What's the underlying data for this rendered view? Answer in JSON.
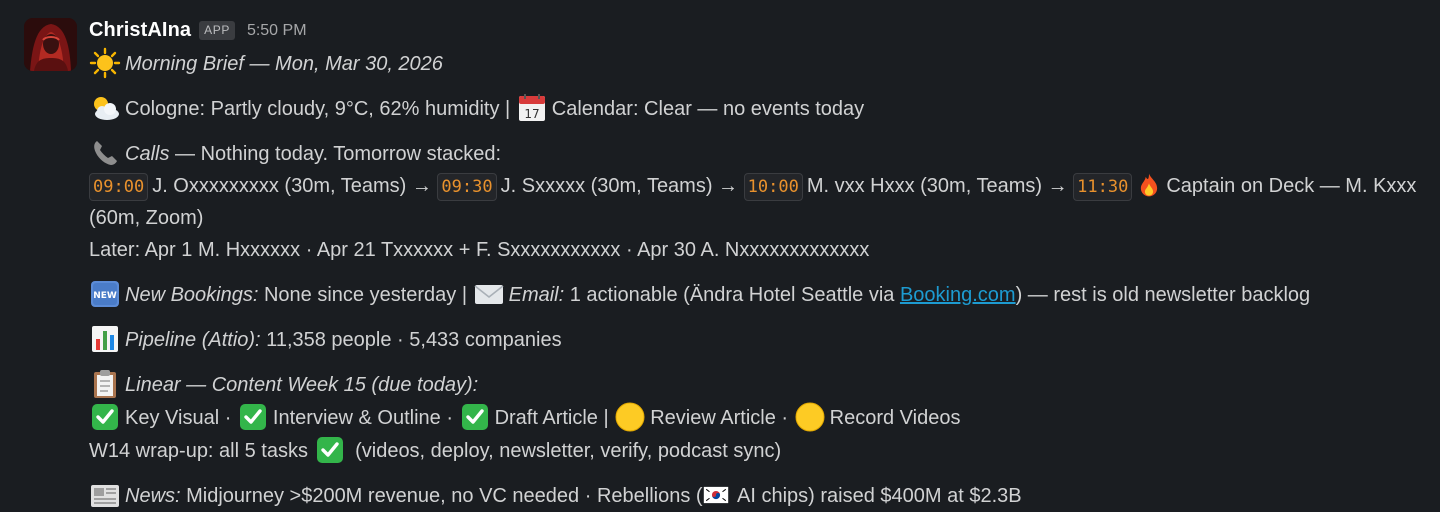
{
  "message": {
    "author": "ChristAIna",
    "badge": "APP",
    "time": "5:50 PM"
  },
  "brief": {
    "title": "Morning Brief — Mon, Mar 30, 2026",
    "weather": "Cologne: Partly cloudy, 9°C, 62% humidity | ",
    "calendar": "Calendar: Clear — no events today",
    "calls_label": "Calls",
    "calls_text": " — Nothing today. Tomorrow stacked:",
    "calls": [
      {
        "time": "09:00",
        "text": "J. Oxxxxxxxxx (30m, Teams) → "
      },
      {
        "time": "09:30",
        "text": "J. Sxxxxx (30m, Teams) → "
      },
      {
        "time": "10:00",
        "text": "M. vxx Hxxx (30m, Teams) → "
      },
      {
        "time": "11:30",
        "text": "Captain on Deck — M. Kxxx (60m, Zoom)"
      }
    ],
    "later": "Later: Apr 1 M. Hxxxxxx · Apr 21 Txxxxxx + F. Sxxxxxxxxxxx · Apr 30 A. Nxxxxxxxxxxxxx",
    "bookings_label": "New Bookings:",
    "bookings_text": " None since yesterday | ",
    "email_label": "Email:",
    "email_text_a": " 1 actionable (Ändra Hotel Seattle via ",
    "email_link": "Booking.com",
    "email_text_b": ") — rest is old newsletter backlog",
    "pipeline_label": "Pipeline (Attio):",
    "pipeline_text": " 11,358 people · 5,433 companies",
    "linear_label": "Linear — Content Week 15 (due today):",
    "tasks": [
      {
        "status": "done",
        "label": "Key Visual",
        "after": " · "
      },
      {
        "status": "done",
        "label": "Interview & Outline",
        "after": " · "
      },
      {
        "status": "done",
        "label": "Draft Article",
        "after": " | "
      },
      {
        "status": "pending",
        "label": "Review Article",
        "after": " · "
      },
      {
        "status": "pending",
        "label": "Record Videos",
        "after": ""
      }
    ],
    "wrapup_a": "W14 wrap-up: all 5 tasks ",
    "wrapup_b": " (videos, deploy, newsletter, verify, podcast sync)",
    "news_label": "News:",
    "news_text_a": " Midjourney >$200M revenue, no VC needed · Rebellions (",
    "news_text_b": " AI chips) raised $400M at $2.3B"
  },
  "icons": {
    "weather": "sun-icon",
    "weather_line": "sun-behind-cloud-icon",
    "calendar": "calendar-icon",
    "calls": "telephone-icon",
    "fire": "fire-icon",
    "new": "new-badge-icon",
    "email": "envelope-icon",
    "pipeline": "bar-chart-icon",
    "linear": "clipboard-icon",
    "done": "check-mark-button-icon",
    "pending": "yellow-circle-icon",
    "news": "newspaper-icon",
    "flag": "south-korea-flag-icon"
  },
  "colors": {
    "background": "#1a1d21",
    "text": "#d1d2d3",
    "code_text": "#e8912d",
    "link": "#1d9bd1",
    "check_green": "#33b54a",
    "pending_yellow": "#fdcb24"
  }
}
